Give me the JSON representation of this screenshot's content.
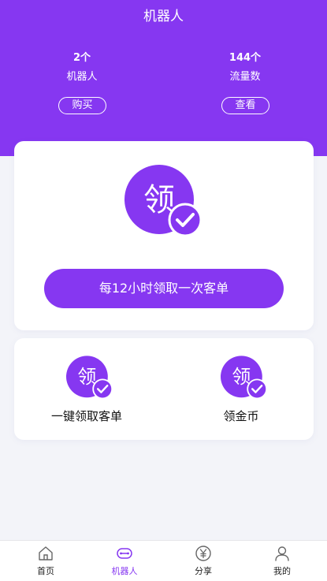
{
  "header": {
    "title": "机器人"
  },
  "stats": [
    {
      "value": "2个",
      "label": "机器人",
      "button_label": "购买"
    },
    {
      "value": "144个",
      "label": "流量数",
      "button_label": "查看"
    }
  ],
  "claim_card": {
    "icon_glyph": "领",
    "button_label": "每12小时领取一次客单"
  },
  "actions": [
    {
      "label": "一键领取客单",
      "icon_glyph": "领"
    },
    {
      "label": "领金币",
      "icon_glyph": "领"
    }
  ],
  "tabbar": {
    "items": [
      {
        "label": "首页",
        "icon": "home-icon"
      },
      {
        "label": "机器人",
        "icon": "robot-icon",
        "active": true
      },
      {
        "label": "分享",
        "icon": "yen-icon"
      },
      {
        "label": "我的",
        "icon": "user-icon"
      }
    ]
  },
  "colors": {
    "accent": "#8637f1",
    "background": "#f3f4f9"
  }
}
